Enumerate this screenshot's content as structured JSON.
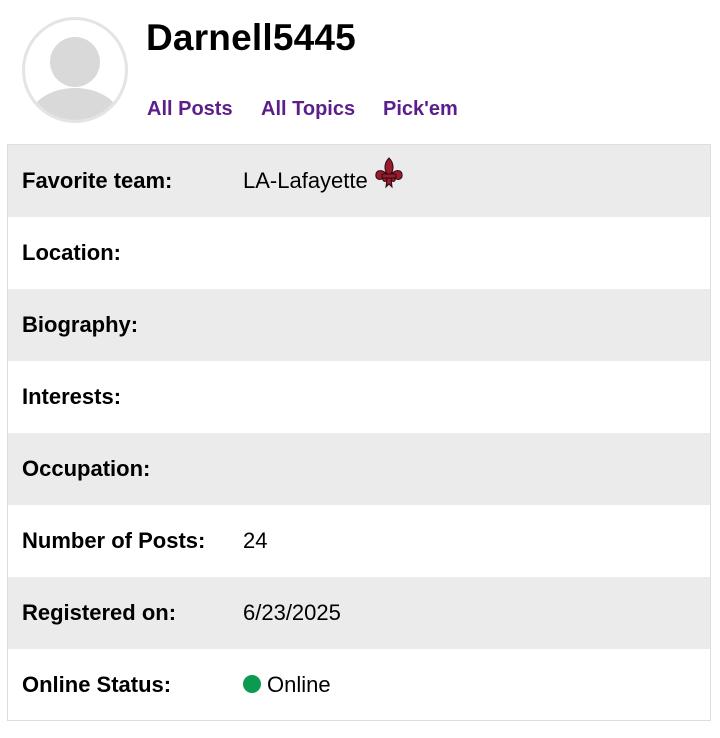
{
  "user": {
    "username": "Darnell5445",
    "avatar_icon": "default-user-avatar-icon"
  },
  "nav": {
    "all_posts": "All Posts",
    "all_topics": "All Topics",
    "pickem": "Pick'em",
    "link_color": "#5c1f8a"
  },
  "profile": {
    "favorite_team_label": "Favorite team:",
    "favorite_team_value": "LA-Lafayette",
    "favorite_team_icon": "fleur-de-lis-icon",
    "location_label": "Location:",
    "location_value": "",
    "biography_label": "Biography:",
    "biography_value": "",
    "interests_label": "Interests:",
    "interests_value": "",
    "occupation_label": "Occupation:",
    "occupation_value": "",
    "posts_label": "Number of Posts:",
    "posts_value": "24",
    "registered_label": "Registered on:",
    "registered_value": "6/23/2025",
    "status_label": "Online Status:",
    "status_value": "Online",
    "status_color": "#0b9a4f"
  }
}
